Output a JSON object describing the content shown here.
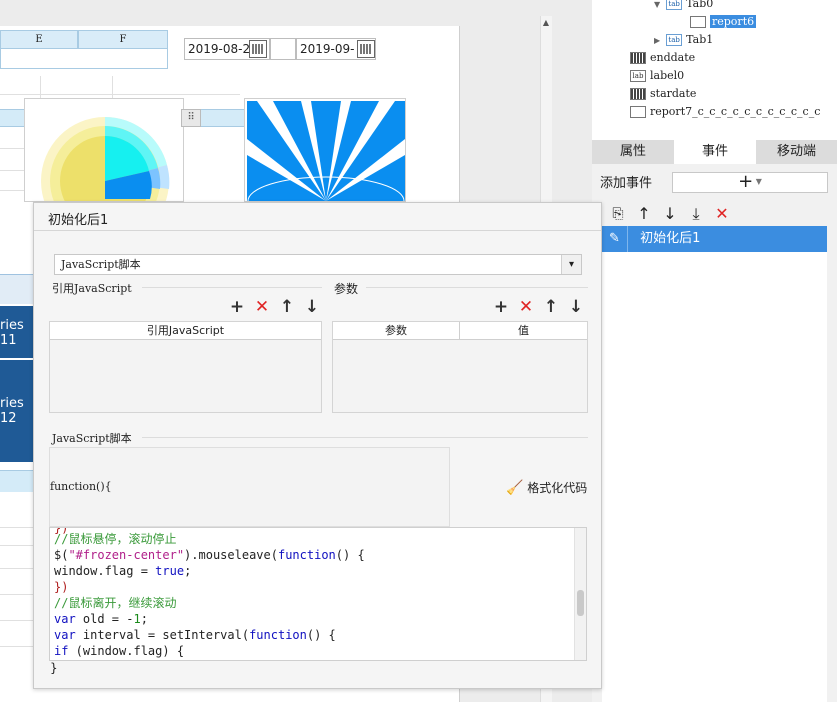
{
  "canvas": {
    "columns": [
      "E",
      "F"
    ],
    "date1": "2019-08-2",
    "date2": "2019-09-",
    "series_labels": [
      "ries\n11",
      "ries\n12"
    ]
  },
  "tree": {
    "items": [
      {
        "icon": "tab",
        "label": "Tab0"
      },
      {
        "icon": "report",
        "label": "report6",
        "selected": true
      },
      {
        "icon": "tab",
        "label": "Tab1"
      },
      {
        "icon": "calendar",
        "label": "enddate"
      },
      {
        "icon": "label",
        "label": "label0"
      },
      {
        "icon": "calendar",
        "label": "stardate"
      },
      {
        "icon": "report",
        "label": "report7_c_c_c_c_c_c_c_c_c_c_c"
      }
    ]
  },
  "panel": {
    "tabs": [
      "属性",
      "事件",
      "移动端"
    ],
    "add_event_label": "添加事件",
    "add_symbol": "+",
    "selected_event": "初始化后1"
  },
  "dialog": {
    "title": "初始化后1",
    "type_select": "JavaScript脚本",
    "refs_group": "引用JavaScript",
    "refs_col": "引用JavaScript",
    "params_group": "参数",
    "params_col1": "参数",
    "params_col2": "值",
    "script_group": "JavaScript脚本",
    "function_head": "function(){",
    "format_label": "格式化代码",
    "closing": "}"
  },
  "code": [
    {
      "text": "})",
      "cls": "pn"
    },
    {
      "text": "//鼠标悬停，滚动停止",
      "cls": "cm"
    },
    {
      "text": "$(\"#frozen-center\").mouseleave(function() {",
      "cls": "mixed1"
    },
    {
      "text": "window.flag = true;",
      "cls": "mixed2"
    },
    {
      "text": "})",
      "cls": "pn"
    },
    {
      "text": "//鼠标离开，继续滚动",
      "cls": "cm"
    },
    {
      "text": "var old = -1;",
      "cls": "mixed3"
    },
    {
      "text": "var interval = setInterval(function() {",
      "cls": "mixed4"
    },
    {
      "text": "if (window.flag) {",
      "cls": "mixed5"
    }
  ],
  "colors": {
    "accent": "#3b8de0",
    "delete": "#e02424",
    "chart_blue": "#0a8ef0",
    "chart_yellow": "#ede06a",
    "chart_cyan": "#16f0f0"
  }
}
